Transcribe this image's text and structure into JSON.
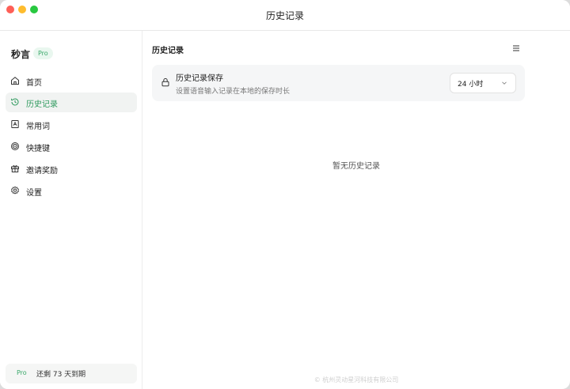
{
  "window": {
    "title": "历史记录"
  },
  "sidebar": {
    "brand": "秒言",
    "badge": "Pro",
    "items": [
      {
        "label": "首页",
        "icon": "home-icon"
      },
      {
        "label": "历史记录",
        "icon": "history-icon",
        "active": true
      },
      {
        "label": "常用词",
        "icon": "wordbook-icon"
      },
      {
        "label": "快捷键",
        "icon": "shortcut-icon"
      },
      {
        "label": "邀请奖励",
        "icon": "gift-icon"
      },
      {
        "label": "设置",
        "icon": "gear-icon"
      }
    ],
    "footer": {
      "badge": "Pro",
      "text": "还剩 73 天到期"
    }
  },
  "main": {
    "title": "历史记录",
    "setting": {
      "title": "历史记录保存",
      "description": "设置语音输入记录在本地的保存时长",
      "value": "24 小时"
    },
    "empty_text": "暂无历史记录",
    "copyright": "© 杭州灵动星河科技有限公司"
  },
  "colors": {
    "accent": "#2f9a5e",
    "badge_bg": "#e9f7ef"
  }
}
